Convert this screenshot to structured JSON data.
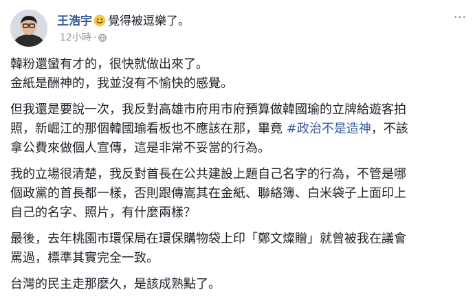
{
  "author": {
    "name": "王浩宇",
    "feeling": "覺得被逗樂了。"
  },
  "meta": {
    "time": "12小時",
    "separator": "·",
    "visibility_icon": "globe-icon"
  },
  "menu": {
    "icon": "more-options-icon",
    "label": "···"
  },
  "post": {
    "p1_l1": "韓粉還蠻有才的，很快就做出來了。",
    "p1_l2": "金紙是酬神的，我並沒有不愉快的感覺。",
    "p2_l1": "但我還是要說一次，我反對高雄市府用市府預算做韓國瑜的立牌給遊客拍",
    "p2_l2": "照，新崛江的那個韓國瑜看板也不應該在那，畢竟 ",
    "p2_hashtag": "#政治不是造神",
    "p2_l2_end": "，不該",
    "p2_l3": "拿公費來做個人宣傳，這是非常不妥當的行為。",
    "p3_l1": "我的立場很清楚，我反對首長在公共建設上題自己名字的行為，不管是哪",
    "p3_l2": "個政黨的首長都一樣，否則跟傳嵩其在金紙、聯絡簿、白米袋子上面印上",
    "p3_l3": "自己的名字、照片，有什麼兩樣？",
    "p4_l1": "最後，去年桃園市環保局在環保購物袋上印「鄭文燦贈」就曾被我在議會",
    "p4_l2": "罵過，標準其實完全一致。",
    "p5_l1": "台灣的民主走那麼久，是該成熟點了。"
  }
}
